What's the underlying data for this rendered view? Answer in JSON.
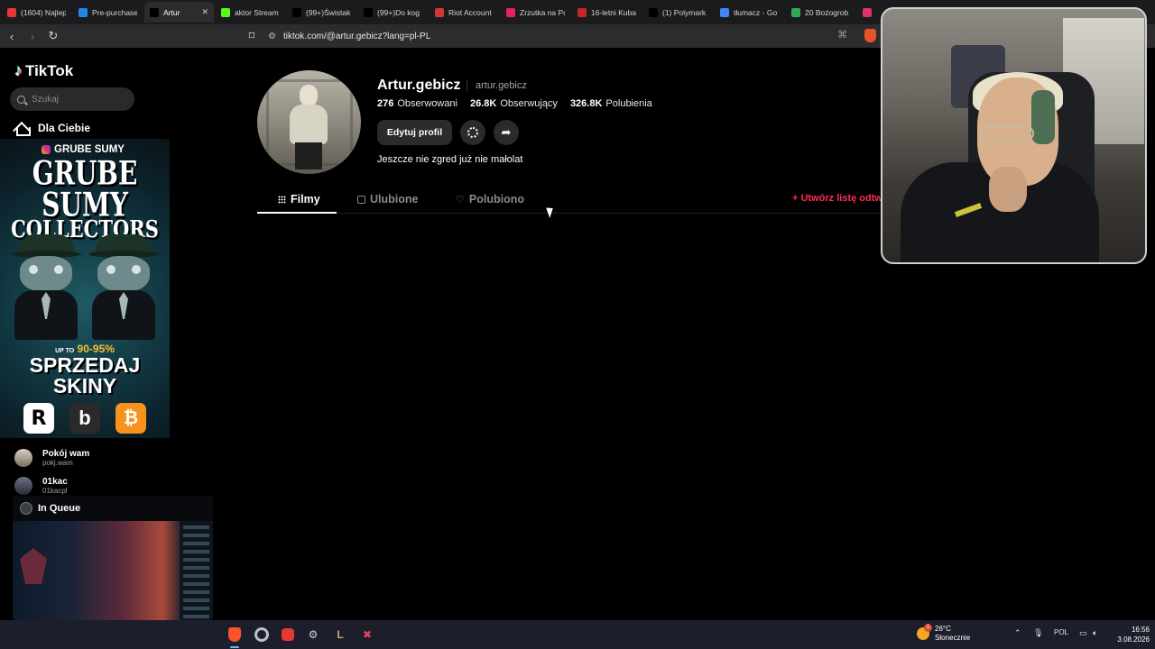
{
  "browser": {
    "tabs": [
      {
        "label": "(1604) Najlep",
        "icon": "youtube-icon",
        "color": "#e53935"
      },
      {
        "label": "Pre-purchase",
        "icon": "check-icon",
        "color": "#1e88e5"
      },
      {
        "label": "Artur",
        "icon": "tiktok-icon",
        "color": "#000000",
        "active": true
      },
      {
        "label": "aktor Stream",
        "icon": "kick-icon",
        "color": "#53fc18"
      },
      {
        "label": "(99+)Świstak",
        "icon": "tiktok-icon",
        "color": "#000000"
      },
      {
        "label": "(99+)Do kog",
        "icon": "tiktok-icon",
        "color": "#000000"
      },
      {
        "label": "Riot Account",
        "icon": "riot-icon",
        "color": "#d13639"
      },
      {
        "label": "Zrzutka na Pc",
        "icon": "zrzutka-icon",
        "color": "#e0245e"
      },
      {
        "label": "16-letni Kuba",
        "icon": "news-icon",
        "color": "#c62828"
      },
      {
        "label": "(1) Polymark",
        "icon": "x-icon",
        "color": "#000000"
      },
      {
        "label": "tłumacz - Go",
        "icon": "google-icon",
        "color": "#4285f4"
      },
      {
        "label": "20 Bożogrob",
        "icon": "maps-icon",
        "color": "#34a853"
      },
      {
        "label": "",
        "icon": "instagram-icon",
        "color": "#e1306c"
      }
    ],
    "close_glyph": "✕",
    "url": "tiktok.com/@artur.gebicz?lang=pl-PL"
  },
  "sidebar": {
    "logo": "TikTok",
    "search_placeholder": "Szukaj",
    "nav_for_you": "Dla Ciebie",
    "ad": {
      "handle": "GRUBE SUMY",
      "headline_1": "GRUBE SUMY",
      "headline_2": "COLLECTORS",
      "promo_prefix": "UP TO",
      "promo_value": "90-95%",
      "sell_1": "SPRZEDAJ",
      "sell_2": "SKINY",
      "logo_1": "R",
      "logo_2": "b",
      "logo_3": "₿"
    },
    "following": [
      {
        "name": "Pokój wam",
        "handle": "pokj.wam"
      },
      {
        "name": "01kac",
        "handle": "01kacpl"
      }
    ]
  },
  "queue_widget": {
    "label": "In Queue"
  },
  "profile": {
    "username": "Artur.gebicz",
    "handle": "artur.gebicz",
    "following_count": "276",
    "following_label": "Obserwowani",
    "followers_count": "26.8K",
    "followers_label": "Obserwujący",
    "likes_count": "326.8K",
    "likes_label": "Polubienia",
    "edit_button": "Edytuj profil",
    "bio": "Jeszcze nie zgred już nie małolat",
    "tabs": {
      "videos": "Filmy",
      "favorites": "Ulubione",
      "liked": "Polubiono"
    },
    "create_playlist": "+ Utwórz listę odtw"
  },
  "taskbar": {
    "apps": [
      "brave-icon",
      "chrome-icon",
      "record-icon",
      "steam-icon",
      "league-icon",
      "riot-client-icon"
    ],
    "weather_temp": "26°C",
    "weather_desc": "Słonecznie",
    "weather_badge": "1",
    "language": "POL",
    "time": "16:56",
    "date": "3.08.2026"
  },
  "colors": {
    "accent_red": "#fe2c55",
    "tiktok_cyan": "#25f4ee"
  }
}
